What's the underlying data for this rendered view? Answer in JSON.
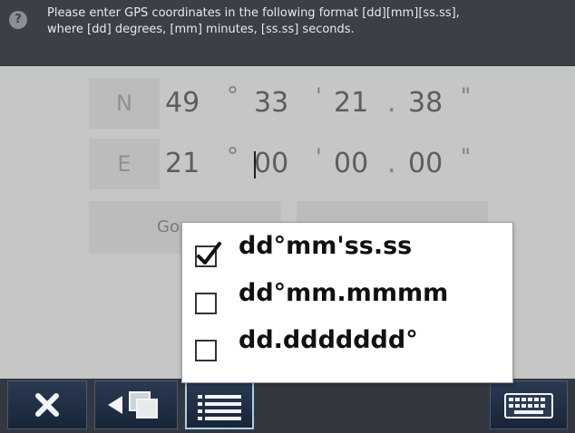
{
  "header": {
    "help_icon_glyph": "?",
    "instruction_line1": "Please enter GPS coordinates in the following format [dd][mm][ss.ss],",
    "instruction_line2": "where [dd] degrees, [mm] minutes, [ss.ss] seconds."
  },
  "north": {
    "label": "N",
    "degrees": "49",
    "minutes": "33",
    "seconds": "21",
    "hundredths": "38"
  },
  "east": {
    "label": "E",
    "degrees": "21",
    "minutes": "00",
    "seconds": "00",
    "hundredths": "00"
  },
  "symbols": {
    "degree": "°",
    "minute": "'",
    "decimal": ".",
    "second": "\""
  },
  "buttons": {
    "go_label": "Go"
  },
  "format_menu": {
    "options": [
      {
        "label": "dd°mm'ss.ss",
        "checked": true
      },
      {
        "label": "dd°mm.mmmm",
        "checked": false
      },
      {
        "label": "dd.ddddddd°",
        "checked": false
      }
    ]
  },
  "toolbar": {
    "icons": [
      "close-icon",
      "back-windows-icon",
      "list-icon",
      "keyboard-icon"
    ]
  },
  "colors": {
    "header_bg": "#3a3f48",
    "content_bg": "#c5c7c4",
    "toolbar_bg": "#33373f",
    "toolbar_button_bg": "#1f2d44",
    "active_border": "#a7d0e8"
  }
}
